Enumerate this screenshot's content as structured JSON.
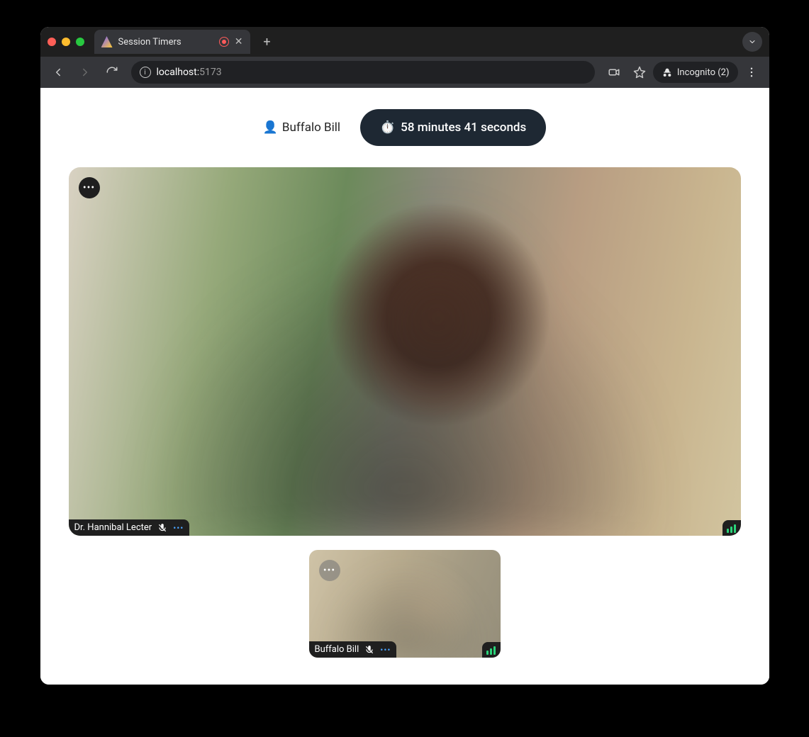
{
  "browser": {
    "tab_title": "Session Timers",
    "url_host": "localhost:",
    "url_port": "5173",
    "incognito_label": "Incognito (2)"
  },
  "header": {
    "user_icon": "👤",
    "user_name": "Buffalo Bill",
    "timer_icon": "⏱️",
    "timer_text": "58 minutes 41 seconds"
  },
  "participants": {
    "main": {
      "name": "Dr. Hannibal Lecter",
      "muted": true
    },
    "self": {
      "name": "Buffalo Bill",
      "muted": true
    }
  }
}
